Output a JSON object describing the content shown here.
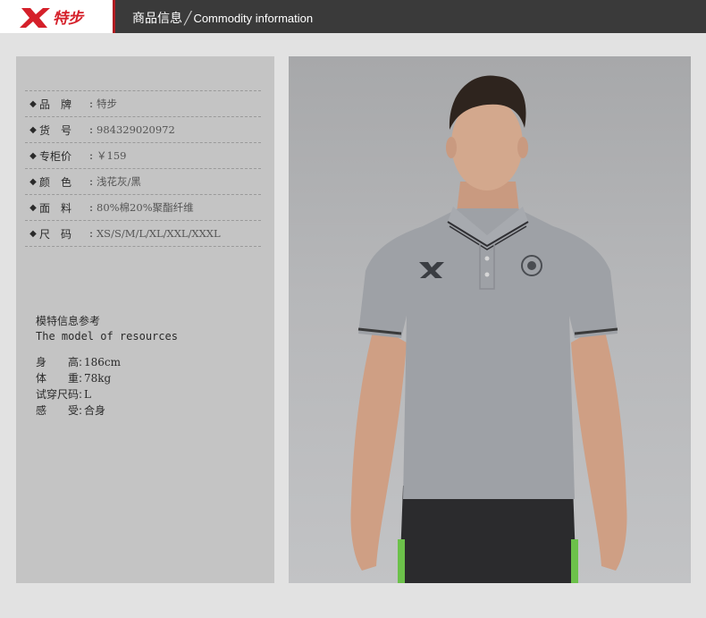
{
  "header": {
    "brand_text": "特步",
    "title_cn": "商品信息",
    "separator": "╱",
    "title_en": "Commodity information"
  },
  "specs": [
    {
      "label": "品　牌",
      "value": "特步"
    },
    {
      "label": "货　号",
      "value": "984329020972"
    },
    {
      "label": "专柜价",
      "value": "￥159"
    },
    {
      "label": "颜　色",
      "value": "浅花灰/黑"
    },
    {
      "label": "面　料",
      "value": "80%棉20%聚酯纤维"
    },
    {
      "label": "尺　码",
      "value": "XS/S/M/L/XL/XXL/XXXL"
    }
  ],
  "bullet": "◆",
  "model": {
    "title_cn": "模特信息参考",
    "title_en": "The model of resources",
    "rows": [
      {
        "label": "身　　高:",
        "value": "186cm"
      },
      {
        "label": "体　　重:",
        "value": "78kg"
      },
      {
        "label": "试穿尺码:",
        "value": "L"
      },
      {
        "label": "感　　受:",
        "value": "合身"
      }
    ]
  },
  "colors": {
    "header_bg": "#3a3a3a",
    "brand_red": "#d5202a",
    "panel_bg": "#c4c4c4",
    "page_bg": "#e2e2e2",
    "shirt": "#9ea1a6"
  }
}
